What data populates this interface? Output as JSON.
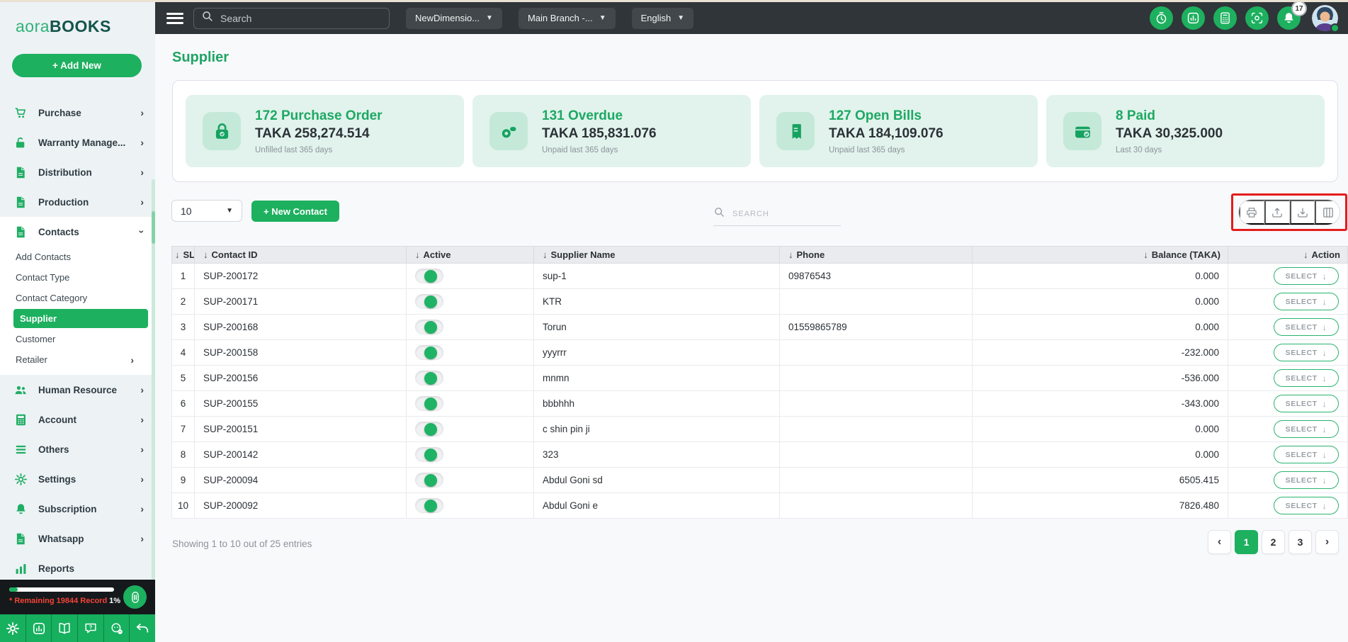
{
  "colors": {
    "brand_green": "#1db05f",
    "heading_green": "#1fa864",
    "topbar_bg": "#303539",
    "sidebar_bg": "#edf2f5",
    "card_bg": "#e1f3ec",
    "annotation_red": "#e41c1c",
    "quota_red": "#f44336"
  },
  "topbar": {
    "search_placeholder": "Search",
    "dropdowns": [
      {
        "label": "NewDimensio..."
      },
      {
        "label": "Main Branch -..."
      },
      {
        "label": "English"
      }
    ],
    "icon_buttons": [
      {
        "icon": "timer"
      },
      {
        "icon": "chartsq"
      },
      {
        "icon": "calco"
      },
      {
        "icon": "scan"
      },
      {
        "icon": "bell",
        "badge": "17"
      }
    ],
    "notification_count": "17"
  },
  "sidebar": {
    "logo_light": "aora",
    "logo_dark": "BOOKS",
    "add_new_label": "+ Add New",
    "items": [
      {
        "label": "Purchase",
        "icon": "cart",
        "chevron": true
      },
      {
        "label": "Warranty Manage...",
        "icon": "unlock",
        "chevron": true
      },
      {
        "label": "Distribution",
        "icon": "doc",
        "chevron": true
      },
      {
        "label": "Production",
        "icon": "doc",
        "chevron": true
      },
      {
        "label": "Contacts",
        "icon": "doc",
        "expanded": true,
        "children": [
          {
            "label": "Add Contacts"
          },
          {
            "label": "Contact Type"
          },
          {
            "label": "Contact Category"
          },
          {
            "label": "Supplier",
            "active": true
          },
          {
            "label": "Customer"
          },
          {
            "label": "Retailer",
            "chevron": true
          }
        ]
      },
      {
        "label": "Human Resource",
        "icon": "people",
        "chevron": true
      },
      {
        "label": "Account",
        "icon": "calc",
        "chevron": true
      },
      {
        "label": "Others",
        "icon": "lines",
        "chevron": true
      },
      {
        "label": "Settings",
        "icon": "gear",
        "chevron": true
      },
      {
        "label": "Subscription",
        "icon": "bell",
        "chevron": true
      },
      {
        "label": "Whatsapp",
        "icon": "doc",
        "chevron": true
      },
      {
        "label": "Reports",
        "icon": "bars",
        "chevron": false
      }
    ],
    "quota": {
      "label": "* Remaining 19844 Record",
      "percent": "1%",
      "progress_pct": 8
    },
    "toolbar_icons": [
      "gear",
      "chartsq",
      "book",
      "help",
      "support",
      "undo"
    ]
  },
  "page": {
    "title": "Supplier",
    "cards": [
      {
        "icon": "lock",
        "title": "172 Purchase Order",
        "amount": "TAKA 258,274.514",
        "caption": "Unfilled last 365 days"
      },
      {
        "icon": "coins",
        "title": "131 Overdue",
        "amount": "TAKA 185,831.076",
        "caption": "Unpaid last 365 days"
      },
      {
        "icon": "bill",
        "title": "127 Open Bills",
        "amount": "TAKA 184,109.076",
        "caption": "Unpaid last 365 days"
      },
      {
        "icon": "wallet",
        "title": "8 Paid",
        "amount": "TAKA 30,325.000",
        "caption": "Last 30 days"
      }
    ],
    "controls": {
      "page_size": "10",
      "new_contact_label": "+ New Contact",
      "search_placeholder": "SEARCH",
      "export_buttons": [
        "printer",
        "upload",
        "download",
        "columns"
      ]
    },
    "table": {
      "columns": [
        "SL",
        "Contact ID",
        "Active",
        "Supplier Name",
        "Phone",
        "Balance (TAKA)",
        "Action"
      ],
      "action_label": "SELECT",
      "rows": [
        {
          "sl": "1",
          "contact_id": "SUP-200172",
          "active": true,
          "supplier_name": "sup-1",
          "phone": "09876543",
          "balance": "0.000"
        },
        {
          "sl": "2",
          "contact_id": "SUP-200171",
          "active": true,
          "supplier_name": "KTR",
          "phone": "",
          "balance": "0.000"
        },
        {
          "sl": "3",
          "contact_id": "SUP-200168",
          "active": true,
          "supplier_name": "Torun",
          "phone": "01559865789",
          "balance": "0.000"
        },
        {
          "sl": "4",
          "contact_id": "SUP-200158",
          "active": true,
          "supplier_name": "yyyrrr",
          "phone": "",
          "balance": "-232.000"
        },
        {
          "sl": "5",
          "contact_id": "SUP-200156",
          "active": true,
          "supplier_name": "mnmn",
          "phone": "",
          "balance": "-536.000"
        },
        {
          "sl": "6",
          "contact_id": "SUP-200155",
          "active": true,
          "supplier_name": "bbbhhh",
          "phone": "",
          "balance": "-343.000"
        },
        {
          "sl": "7",
          "contact_id": "SUP-200151",
          "active": true,
          "supplier_name": "c shin pin ji",
          "phone": "",
          "balance": "0.000"
        },
        {
          "sl": "8",
          "contact_id": "SUP-200142",
          "active": true,
          "supplier_name": "323",
          "phone": "",
          "balance": "0.000"
        },
        {
          "sl": "9",
          "contact_id": "SUP-200094",
          "active": true,
          "supplier_name": "Abdul Goni sd",
          "phone": "",
          "balance": "6505.415"
        },
        {
          "sl": "10",
          "contact_id": "SUP-200092",
          "active": true,
          "supplier_name": "Abdul Goni e",
          "phone": "",
          "balance": "7826.480"
        }
      ]
    },
    "footer": {
      "summary": "Showing 1 to 10 out of 25 entries",
      "pages": [
        "1",
        "2",
        "3"
      ],
      "active_page": "1"
    }
  }
}
